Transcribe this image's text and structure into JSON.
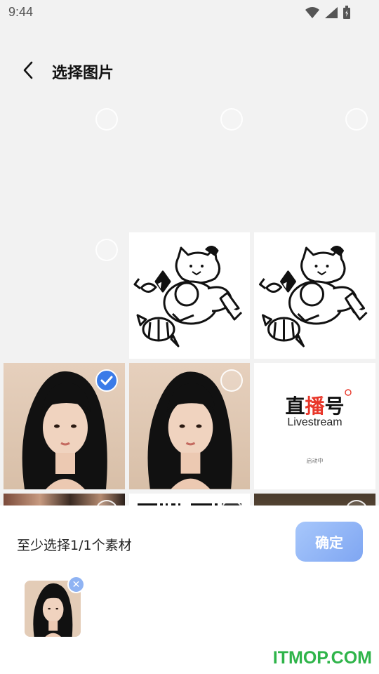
{
  "status_bar": {
    "time": "9:44"
  },
  "header": {
    "title": "选择图片"
  },
  "grid": {
    "livestream": {
      "title_left": "直",
      "title_red": "播",
      "title_right": "号",
      "subtitle": "Livestream",
      "tiny": "启动中"
    }
  },
  "footer": {
    "hint": "至少选择1/1个素材",
    "confirm_label": "确定",
    "remove_label": "✕",
    "watermark": "ITMOP.COM"
  }
}
